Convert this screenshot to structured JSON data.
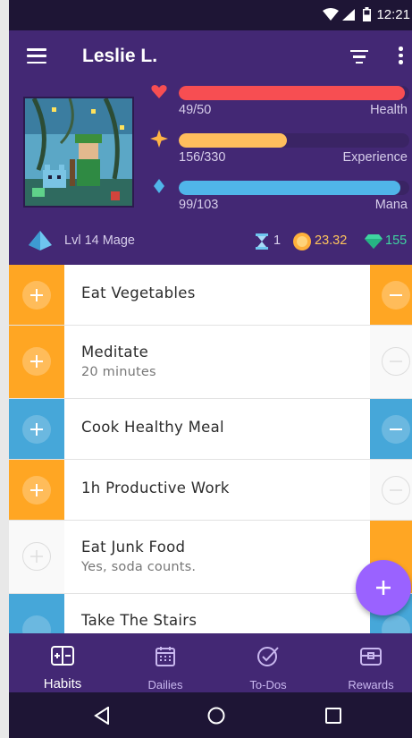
{
  "status_bar": {
    "time": "12:21"
  },
  "app_bar": {
    "user_name": "Leslie L."
  },
  "stats": {
    "health": {
      "current": "49/50",
      "label": "Health",
      "fraction": 0.98,
      "color": "#f74e52"
    },
    "experience": {
      "current": "156/330",
      "label": "Experience",
      "fraction": 0.47,
      "color": "#ffbe5d"
    },
    "mana": {
      "current": "99/103",
      "label": "Mana",
      "fraction": 0.96,
      "color": "#50b5e9"
    }
  },
  "level": {
    "text": "Lvl 14 Mage"
  },
  "currencies": {
    "hourglasses": "1",
    "gold": "23.32",
    "gems": "155"
  },
  "habits": [
    {
      "title": "Eat Vegetables",
      "notes": "",
      "plus_color": "#ffa623",
      "minus_color": "#ffa623"
    },
    {
      "title": "Meditate",
      "notes": "20 minutes",
      "plus_color": "#ffa623",
      "minus_color": "#f9f9f9"
    },
    {
      "title": "Cook Healthy Meal",
      "notes": "",
      "plus_color": "#46a7d9",
      "minus_color": "#46a7d9"
    },
    {
      "title": "1h Productive Work",
      "notes": "",
      "plus_color": "#ffa623",
      "minus_color": "#f9f9f9"
    },
    {
      "title": "Eat Junk Food",
      "notes": "Yes, soda counts.",
      "plus_color": "#f9f9f9",
      "minus_color": "#ffa623"
    },
    {
      "title": "Take The Stairs",
      "notes": "",
      "plus_color": "#46a7d9",
      "minus_color": "#46a7d9"
    }
  ],
  "bottom_nav": {
    "habits": "Habits",
    "dailies": "Dailies",
    "todos": "To-Dos",
    "rewards": "Rewards"
  },
  "colors": {
    "header": "#432874",
    "status": "#1e1535",
    "fab": "#9a62ff"
  }
}
